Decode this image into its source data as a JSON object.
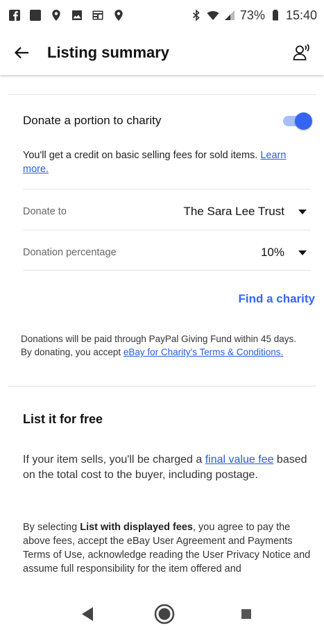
{
  "status_bar": {
    "left_icons": [
      "facebook-icon",
      "app-icon",
      "location-pin-icon",
      "image-icon",
      "news-icon",
      "location-pin-icon"
    ],
    "right_icons": [
      "bluetooth-icon",
      "wifi-icon",
      "signal-icon",
      "battery-icon"
    ],
    "battery_percent": "73%",
    "time": "15:40"
  },
  "app_bar": {
    "title": "Listing summary",
    "back_icon": "arrow-left-icon",
    "account_icon": "account-voice-icon"
  },
  "charity": {
    "donate_label": "Donate a portion to charity",
    "toggle_on": true,
    "accent_color": "#3665f3",
    "credit_text": "You'll get a credit on basic selling fees for sold items. ",
    "credit_link": "Learn more.",
    "donate_to_label": "Donate to",
    "donate_to_value": "The Sara Lee Trust",
    "percentage_label": "Donation percentage",
    "percentage_value": "10%",
    "find_charity": "Find a charity",
    "note_text": "Donations will be paid through PayPal Giving Fund within 45 days. By donating, you accept ",
    "note_link": "eBay for Charity's Terms & Conditions."
  },
  "list_free": {
    "title": "List it for free",
    "fee_text_before": "If your item sells, you'll be charged a ",
    "fee_link": "final value fee",
    "fee_text_after": " based on the total cost to the buyer, including postage.",
    "agree_before": "By selecting ",
    "agree_bold": "List with displayed fees",
    "agree_after": ", you agree to pay the above fees, accept the eBay User Agreement and Payments Terms of Use, acknowledge reading the User Privacy Notice and assume full responsibility for the item offered and"
  },
  "nav_bar": {
    "back_icon": "triangle-back-icon",
    "home_icon": "circle-home-icon",
    "recent_icon": "square-recents-icon"
  }
}
